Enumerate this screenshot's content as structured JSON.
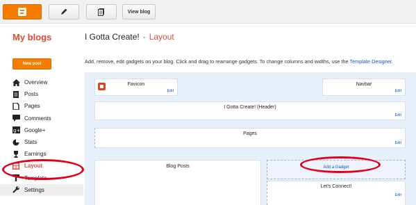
{
  "topbar": {
    "view_blog": "View blog",
    "icons": [
      "blogger-logo-icon",
      "pencil-icon",
      "pages-icon"
    ]
  },
  "sidebar": {
    "title": "My blogs",
    "new_post": "New post",
    "items": [
      {
        "label": "Overview",
        "icon": "home-icon"
      },
      {
        "label": "Posts",
        "icon": "posts-icon"
      },
      {
        "label": "Pages",
        "icon": "pages-icon"
      },
      {
        "label": "Comments",
        "icon": "comments-icon"
      },
      {
        "label": "Google+",
        "icon": "google-plus-icon"
      },
      {
        "label": "Stats",
        "icon": "stats-icon"
      },
      {
        "label": "Earnings",
        "icon": "trophy-icon"
      },
      {
        "label": "Layout",
        "icon": "layout-icon",
        "active": true
      },
      {
        "label": "Template",
        "icon": "template-icon"
      },
      {
        "label": "Settings",
        "icon": "wrench-icon"
      }
    ]
  },
  "header": {
    "blog_name": "I Gotta Create!",
    "separator": "·",
    "section": "Layout",
    "description": "Add, remove, edit gadgets on your blog. Click and drag to rearrange gadgets. To change columns and widths, use the ",
    "designer_link": "Template Designer."
  },
  "layout": {
    "favicon": {
      "title": "Favicon",
      "edit": "Edit"
    },
    "navbar": {
      "title": "Navbar",
      "edit": "Edit"
    },
    "header_gadget": {
      "title": "I Gotta Create! (Header)",
      "edit": "Edit"
    },
    "pages_gadget": {
      "title": "Pages",
      "edit": "Edit"
    },
    "blog_posts": {
      "title": "Blog Posts"
    },
    "add_gadget": "Add a Gadget",
    "lets_connect": {
      "title": "Let's Connect!",
      "edit": "Edit"
    }
  },
  "colors": {
    "accent": "#dd4b39",
    "blogger_orange": "#f57d00",
    "link": "#1155cc",
    "annotation_red": "#e3001b"
  }
}
